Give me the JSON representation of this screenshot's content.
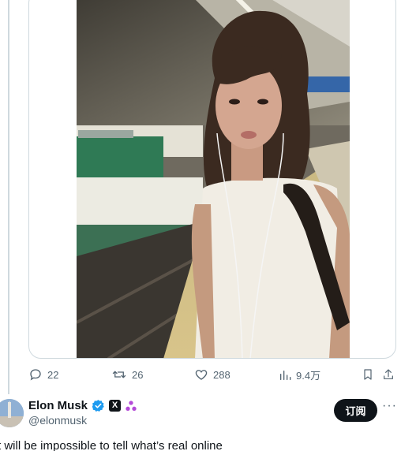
{
  "actions": {
    "reply_count": "22",
    "retweet_count": "26",
    "like_count": "288",
    "views_count": "9.4万"
  },
  "author": {
    "name": "Elon Musk",
    "handle": "@elonmusk",
    "subscribe_label": "订阅",
    "more_label": "···",
    "x_badge_letter": "X"
  },
  "tweet": {
    "text": "t will be impossible to tell what’s real online"
  },
  "colors": {
    "verified": "#1d9bf0",
    "text_secondary": "#536471",
    "subscribe_bg": "#0f1419",
    "border": "#cfd9de"
  }
}
